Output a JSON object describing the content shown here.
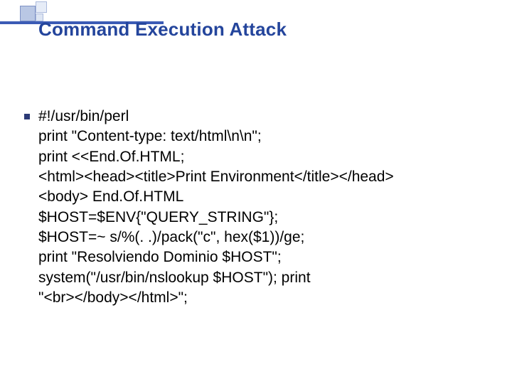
{
  "slide": {
    "title": "Command Execution Attack",
    "code": {
      "l1": "#!/usr/bin/perl",
      "l2": "print \"Content-type: text/html\\n\\n\";",
      "l3": "print <<End.Of.HTML;",
      "l4": "<html><head><title>Print Environment</title></head>",
      "l5": "<body> End.Of.HTML",
      "l6": "$HOST=$ENV{\"QUERY_STRING\"};",
      "l7": "$HOST=~ s/%(. .)/pack(\"c\", hex($1))/ge;",
      "l8": "print \"Resolviendo Dominio $HOST\";",
      "l9": "system(\"/usr/bin/nslookup $HOST\"); print",
      "l10": "\"<br></body></html>\";"
    }
  }
}
